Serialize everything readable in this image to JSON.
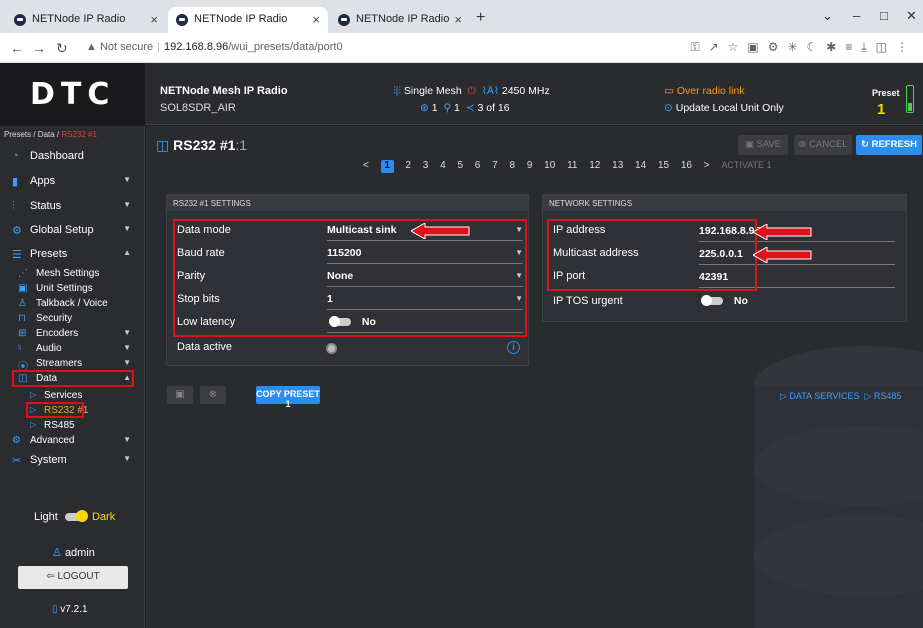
{
  "browser": {
    "tabs": [
      {
        "title": "NETNode IP Radio"
      },
      {
        "title": "NETNode IP Radio"
      },
      {
        "title": "NETNode IP Radio"
      }
    ],
    "url_warning": "Not secure",
    "url_host": "192.168.8.96",
    "url_path": "/wui_presets/data/port0"
  },
  "header": {
    "logo": "DTC",
    "product_name": "NETNode Mesh IP Radio",
    "device_name": "SOL8SDR_AIR",
    "mesh_mode": "Single Mesh",
    "frequency": "2450 MHz",
    "node_count": "1",
    "location_count": "1",
    "share_count": "3 of 16",
    "radio_link": "Over radio link",
    "update_mode": "Update Local Unit Only",
    "preset_label": "Preset",
    "preset_number": "1"
  },
  "sidebar": {
    "breadcrumb": "Presets / Data / ",
    "breadcrumb_current": "RS232 #1",
    "items": [
      {
        "label": "Dashboard",
        "icon": "dashboard-icon"
      },
      {
        "label": "Apps",
        "icon": "apps-icon"
      },
      {
        "label": "Status",
        "icon": "status-icon"
      },
      {
        "label": "Global Setup",
        "icon": "gear-icon"
      },
      {
        "label": "Presets",
        "icon": "presets-icon"
      }
    ],
    "preset_sub": [
      {
        "label": "Mesh Settings"
      },
      {
        "label": "Unit Settings"
      },
      {
        "label": "Talkback / Voice"
      },
      {
        "label": "Security"
      },
      {
        "label": "Encoders"
      },
      {
        "label": "Audio"
      },
      {
        "label": "Streamers"
      },
      {
        "label": "Data"
      }
    ],
    "data_sub": [
      {
        "label": "Services"
      },
      {
        "label": "RS232 #1"
      },
      {
        "label": "RS485"
      }
    ],
    "advanced": "Advanced",
    "system": "System",
    "theme_light": "Light",
    "theme_dark": "Dark",
    "user": "admin",
    "logout": "LOGOUT",
    "version": "v7.2.1"
  },
  "main": {
    "title": "RS232 #1",
    "title_suffix": ":1",
    "save": "SAVE",
    "cancel": "CANCEL",
    "refresh": "REFRESH",
    "pages": [
      "1",
      "2",
      "3",
      "4",
      "5",
      "6",
      "7",
      "8",
      "9",
      "10",
      "11",
      "12",
      "13",
      "14",
      "15",
      "16"
    ],
    "activate": "ACTIVATE 1",
    "rs232_panel": {
      "heading": "RS232 #1 SETTINGS",
      "rows": [
        {
          "label": "Data mode",
          "value": "Multicast sink"
        },
        {
          "label": "Baud rate",
          "value": "115200"
        },
        {
          "label": "Parity",
          "value": "None"
        },
        {
          "label": "Stop bits",
          "value": "1"
        },
        {
          "label": "Low latency",
          "value": "No"
        },
        {
          "label": "Data active",
          "value": ""
        }
      ]
    },
    "network_panel": {
      "heading": "NETWORK SETTINGS",
      "rows": [
        {
          "label": "IP address",
          "value": "192.168.8.95"
        },
        {
          "label": "Multicast address",
          "value": "225.0.0.1"
        },
        {
          "label": "IP port",
          "value": "42391"
        },
        {
          "label": "IP TOS urgent",
          "value": "No"
        }
      ]
    },
    "copy_preset": "COPY PRESET 1",
    "link_services": "DATA SERVICES",
    "link_rs485": "RS485"
  },
  "colors": {
    "accent": "#2a8ef0",
    "highlight_box": "#e0101a",
    "preset_yellow": "#f5d90a",
    "active_link": "#f5a623"
  }
}
